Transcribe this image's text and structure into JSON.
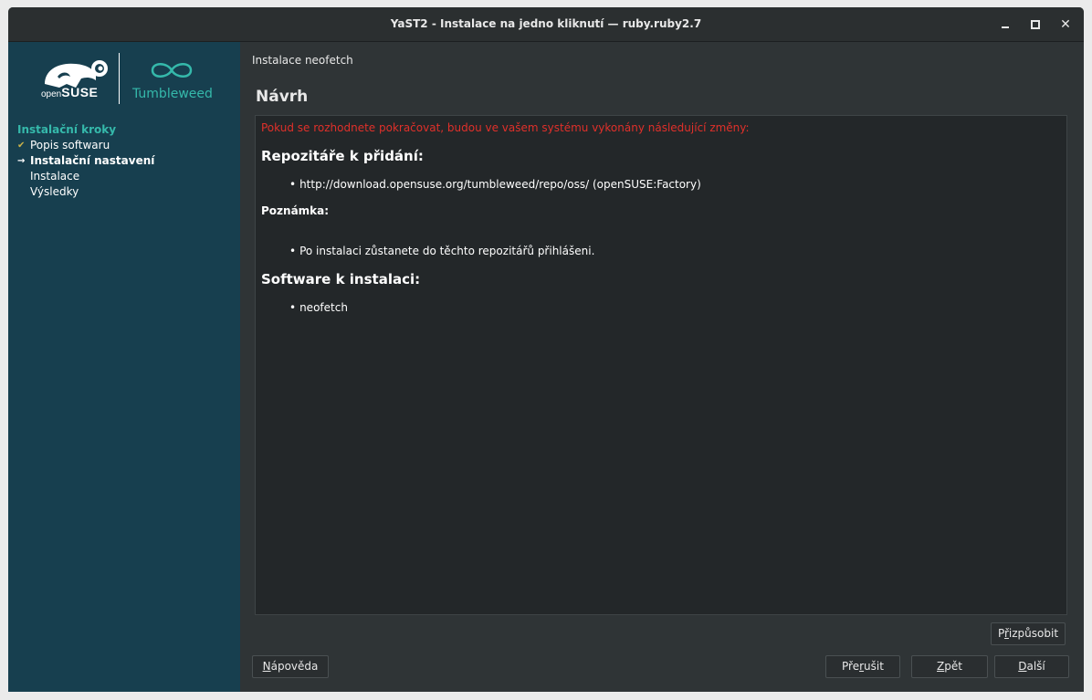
{
  "window": {
    "title": "YaST2 - Instalace na jedno kliknutí — ruby.ruby2.7",
    "icons": {
      "minimize": "minimize-icon",
      "maximize": "maximize-icon",
      "close": "close-icon"
    },
    "close_glyph": "✕"
  },
  "sidebar": {
    "background": "#173f4f",
    "logo": {
      "opensuse_prefix": "open",
      "opensuse_name": "SUSE",
      "tumbleweed": "Tumbleweed",
      "accent": "#35b9ab"
    },
    "steps_title": "Instalační kroky",
    "steps": [
      {
        "label": "Popis softwaru",
        "state": "done",
        "marker": "✔"
      },
      {
        "label": "Instalační nastavení",
        "state": "current",
        "marker": "→"
      },
      {
        "label": "Instalace",
        "state": "pending",
        "marker": ""
      },
      {
        "label": "Výsledky",
        "state": "pending",
        "marker": ""
      }
    ]
  },
  "content": {
    "header_label": "Instalace neofetch",
    "section_title": "Návrh",
    "warning": "Pokud se rozhodnete pokračovat, budou ve vašem systému vykonány následující změny:",
    "warning_color": "#e0302a",
    "repos_heading": "Repozitáře k přidání:",
    "repos": [
      "http://download.opensuse.org/tumbleweed/repo/oss/ (openSUSE:Factory)"
    ],
    "note_heading": "Poznámka:",
    "notes": [
      "Po instalaci zůstanete do těchto repozitářů přihlášeni."
    ],
    "software_heading": "Software k instalaci:",
    "software": [
      "neofetch"
    ],
    "bullet": "•"
  },
  "buttons": {
    "customize": {
      "pre": "P",
      "ul": "ř",
      "post": "izpůsobit"
    },
    "help": {
      "pre": "",
      "ul": "N",
      "post": "ápověda"
    },
    "abort": {
      "pre": "Pře",
      "ul": "r",
      "post": "ušit"
    },
    "back": {
      "pre": "",
      "ul": "Z",
      "post": "pět"
    },
    "next": {
      "pre": "",
      "ul": "D",
      "post": "alší"
    }
  }
}
